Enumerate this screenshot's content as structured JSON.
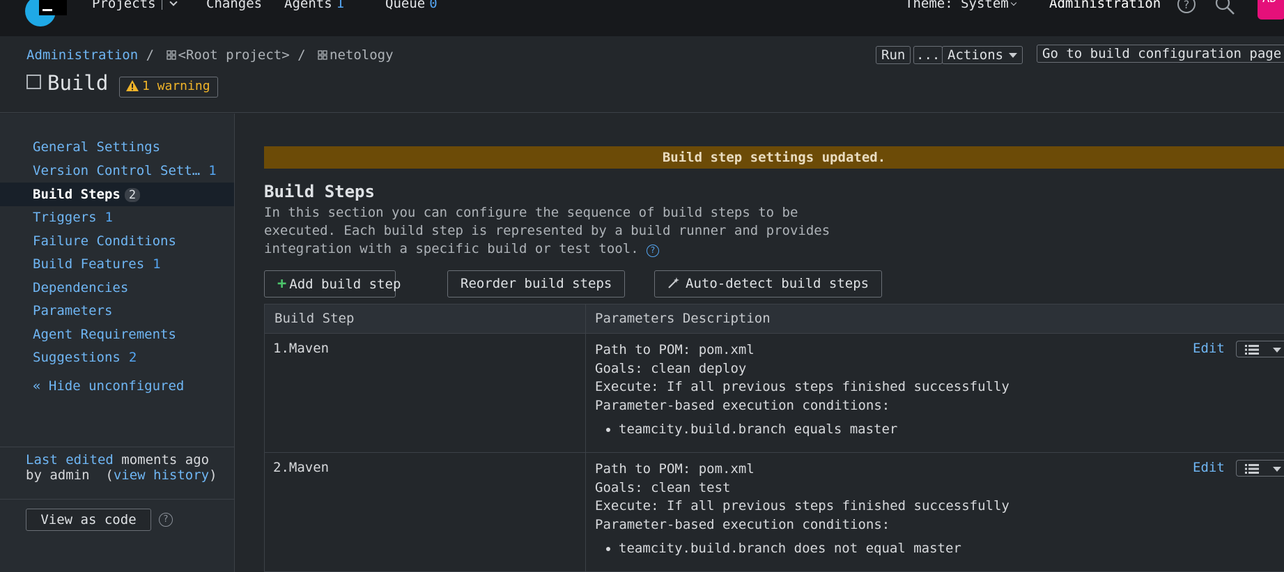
{
  "topbar": {
    "logo_text": "TC",
    "nav": {
      "projects": "Projects",
      "changes": "Changes",
      "agents": "Agents",
      "agents_count": "1",
      "queue": "Queue",
      "queue_count": "0"
    },
    "theme": "Theme: System",
    "administration": "Administration",
    "avatar": "AD"
  },
  "header": {
    "breadcrumb": [
      "Administration",
      "/",
      "<Root project>",
      "/",
      "netology"
    ],
    "title": "Build",
    "warning": "1 warning",
    "run_label": "Run",
    "run_more": "...",
    "actions_label": "Actions",
    "goto_label": "Go to build configuration page"
  },
  "sidebar": {
    "items": [
      {
        "label": "General Settings",
        "count": ""
      },
      {
        "label": "Version Control Sett…",
        "count": "1"
      },
      {
        "label": "Build Steps",
        "count": "2"
      },
      {
        "label": "Triggers",
        "count": "1"
      },
      {
        "label": "Failure Conditions",
        "count": ""
      },
      {
        "label": "Build Features",
        "count": "1"
      },
      {
        "label": "Dependencies",
        "count": ""
      },
      {
        "label": "Parameters",
        "count": ""
      },
      {
        "label": "Agent Requirements",
        "count": ""
      },
      {
        "label": "Suggestions",
        "count": "2"
      }
    ],
    "hide_unconfigured": "« Hide unconfigured",
    "last_edited_link": "Last edited",
    "last_edited_when": "moments ago",
    "by_admin": "by admin",
    "view_history": "view history",
    "view_as_code": "View as code"
  },
  "main": {
    "banner": "Build step settings updated.",
    "title": "Build Steps",
    "description": "In this section you can configure the sequence of build steps to be executed. Each build step is represented by a build runner and provides integration with a specific build or test tool.",
    "buttons": {
      "add": "Add build step",
      "reorder": "Reorder build steps",
      "autodetect": "Auto-detect build steps"
    },
    "table": {
      "headers": [
        "Build Step",
        "Parameters Description"
      ],
      "edit_label": "Edit",
      "rows": [
        {
          "number": "1.",
          "name": "Maven",
          "pom": "Path to POM: pom.xml",
          "goals": "Goals: clean deploy",
          "execute": "Execute: If all previous steps finished successfully",
          "conditions_label": "Parameter-based execution conditions:",
          "condition": "teamcity.build.branch equals master"
        },
        {
          "number": "2.",
          "name": "Maven",
          "pom": "Path to POM: pom.xml",
          "goals": "Goals: clean test",
          "execute": "Execute: If all previous steps finished successfully",
          "conditions_label": "Parameter-based execution conditions:",
          "condition": "teamcity.build.branch does not equal master"
        }
      ]
    }
  },
  "colors": {
    "accent": "#6fb6f4",
    "banner": "#6c4b07",
    "warning": "#f0b429",
    "avatar": "#e5107a"
  }
}
